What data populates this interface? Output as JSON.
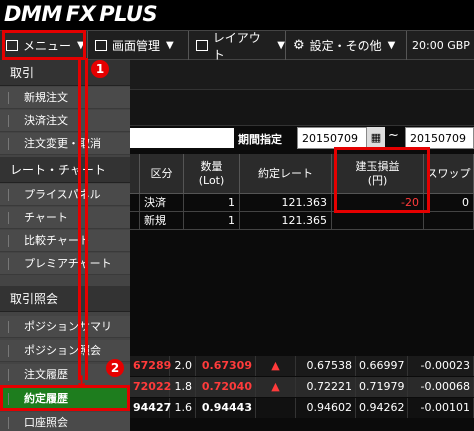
{
  "header": {
    "logo_dmm": "DMM",
    "logo_fx": "FX",
    "logo_plus": "PLUS"
  },
  "toolbar": {
    "menu_label": "メニュー",
    "screen_label": "画面管理",
    "layout_label": "レイアウト",
    "settings_label": "設定・その他",
    "clock": "20:00  GBP"
  },
  "filter": {
    "period_label": "期間指定",
    "date_from": "20150709",
    "tilde": "~",
    "date_to": "20150709"
  },
  "table": {
    "headers": {
      "division": "区分",
      "quantity": "数量\n(Lot)",
      "rate": "約定レート",
      "pl_line1": "建玉損益",
      "pl_line2": "(円)",
      "swap": "スワップ"
    },
    "rows": [
      {
        "division": "決済",
        "quantity": "1",
        "rate": "121.363",
        "pl": "-20",
        "swap": "0"
      },
      {
        "division": "新規",
        "quantity": "1",
        "rate": "121.365",
        "pl": "",
        "swap": ""
      }
    ]
  },
  "prices": [
    {
      "bid": "67289",
      "spread": "2.0",
      "ask": "0.67309",
      "arrow": "▲",
      "high": "0.67538",
      "low": "0.66997",
      "change": "-0.00023"
    },
    {
      "bid": "72022",
      "spread": "1.8",
      "ask": "0.72040",
      "arrow": "▲",
      "high": "0.72221",
      "low": "0.71979",
      "change": "-0.00068"
    },
    {
      "bid": "94427",
      "spread": "1.6",
      "ask": "0.94443",
      "arrow": "",
      "high": "0.94602",
      "low": "0.94262",
      "change": "-0.00101"
    }
  ],
  "menu": {
    "section_trade": "取引",
    "new_order": "新規注文",
    "settle_order": "決済注文",
    "order_change": "注文変更・取消",
    "section_rate": "レート・チャート",
    "price_panel": "プライスパネル",
    "chart": "チャート",
    "compare_chart": "比較チャート",
    "premier_chart": "プレミアチャート",
    "section_inquiry": "取引照会",
    "position_summary": "ポジションサマリ",
    "position_inquiry": "ポジション照会",
    "order_history": "注文履歴",
    "execution_history": "約定履歴",
    "account_inquiry": "口座照会"
  },
  "annotations": {
    "badge1": "1",
    "badge2": "2"
  },
  "colors": {
    "highlight": "#e50000",
    "active_menu": "#1e7d1e",
    "negative": "#ff3b3b"
  }
}
